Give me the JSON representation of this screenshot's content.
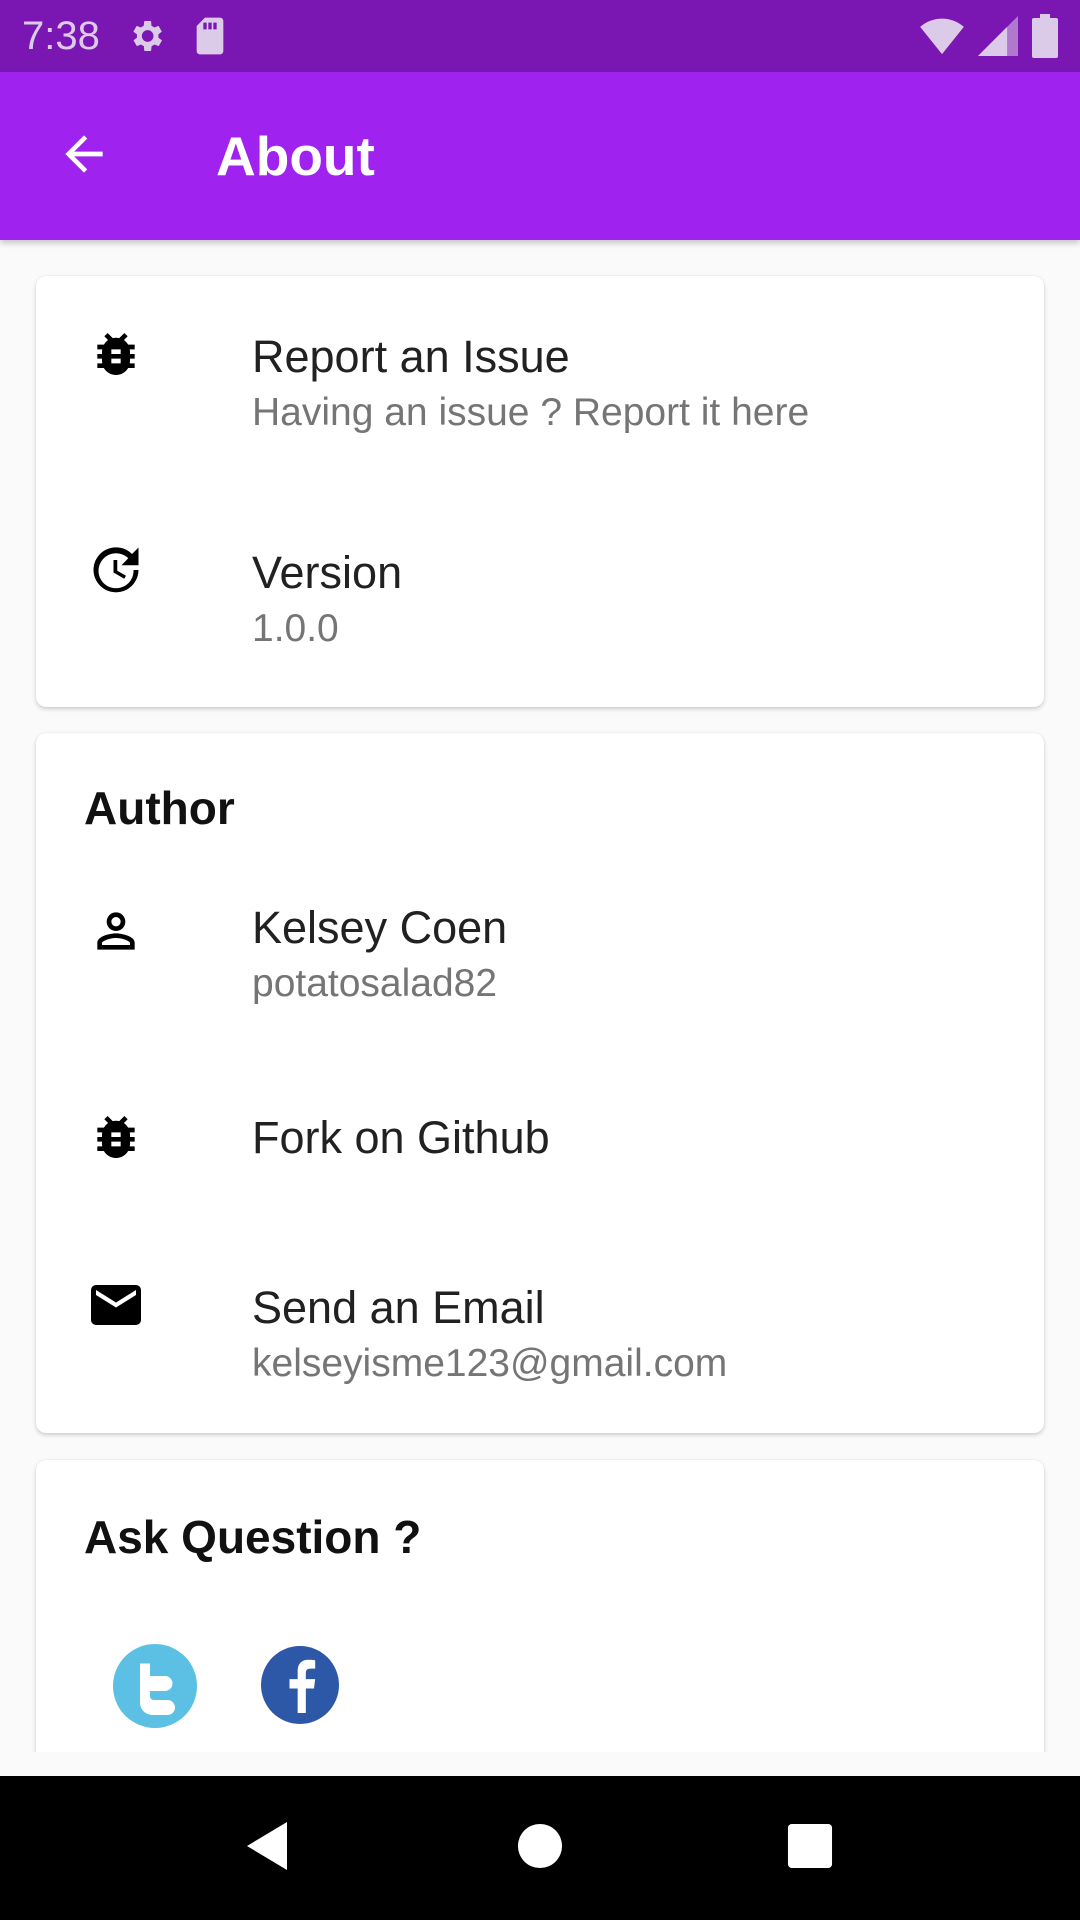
{
  "status_bar": {
    "time": "7:38",
    "icons": [
      "gear-icon",
      "sd-card-icon",
      "wifi-icon",
      "signal-icon",
      "battery-icon"
    ]
  },
  "app_bar": {
    "title": "About",
    "back_icon": "arrow-back-icon"
  },
  "info_card": {
    "items": [
      {
        "icon": "bug-icon",
        "title": "Report an Issue",
        "subtitle": "Having an issue ? Report it here"
      },
      {
        "icon": "update-icon",
        "title": "Version",
        "subtitle": "1.0.0"
      }
    ]
  },
  "author_card": {
    "header": "Author",
    "items": [
      {
        "icon": "person-icon",
        "title": "Kelsey Coen",
        "subtitle": "potatosalad82"
      },
      {
        "icon": "bug-icon",
        "title": "Fork on Github"
      },
      {
        "icon": "email-icon",
        "title": "Send an Email",
        "subtitle": "kelseyisme123@gmail.com"
      }
    ]
  },
  "question_card": {
    "header": "Ask Question ?",
    "socials": [
      {
        "icon": "twitter-icon",
        "color": "#5bc0e3"
      },
      {
        "icon": "facebook-icon",
        "color": "#2d58a7"
      }
    ]
  },
  "colors": {
    "status_bar": "#7a17b2",
    "app_bar": "#9f22ee",
    "primary_text": "#212121",
    "secondary_text": "#757575"
  },
  "nav_bar": {
    "buttons": [
      "back-triangle-icon",
      "home-circle-icon",
      "recents-square-icon"
    ]
  }
}
